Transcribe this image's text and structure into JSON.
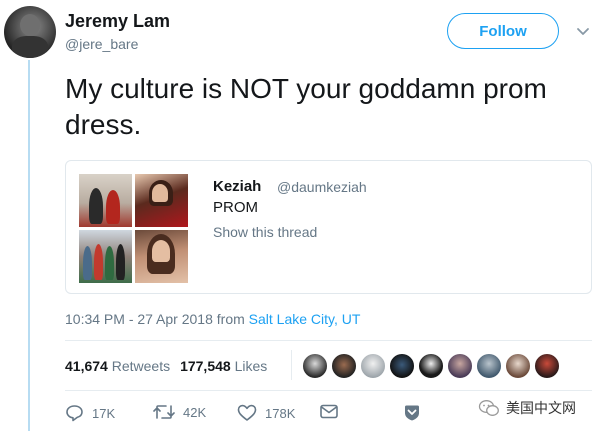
{
  "author": {
    "name": "Jeremy Lam",
    "handle": "@jere_bare"
  },
  "follow_button": {
    "label": "Follow"
  },
  "tweet": {
    "text": "My culture is NOT your goddamn prom dress."
  },
  "quoted_tweet": {
    "name": "Keziah",
    "handle": "@daumkeziah",
    "text": "PROM",
    "thread_link": "Show this thread"
  },
  "meta": {
    "time_date": "10:34 PM - 27 Apr 2018 from ",
    "location": "Salt Lake City, UT"
  },
  "stats": {
    "retweets_count": "41,674",
    "retweets_label": "Retweets",
    "likes_count": "177,548",
    "likes_label": "Likes"
  },
  "actions": {
    "reply_count": "17K",
    "retweet_count": "42K",
    "like_count": "178K"
  },
  "watermark": {
    "text": "美国中文网"
  },
  "colors": {
    "accent": "#1da1f2",
    "secondary_text": "#657786",
    "primary_text": "#14171a",
    "thread_rule": "#b7dcf2"
  },
  "icons": [
    "chevron-down-icon",
    "reply-icon",
    "retweet-icon",
    "heart-icon",
    "message-icon",
    "share-badge-icon",
    "wechat-icon"
  ]
}
